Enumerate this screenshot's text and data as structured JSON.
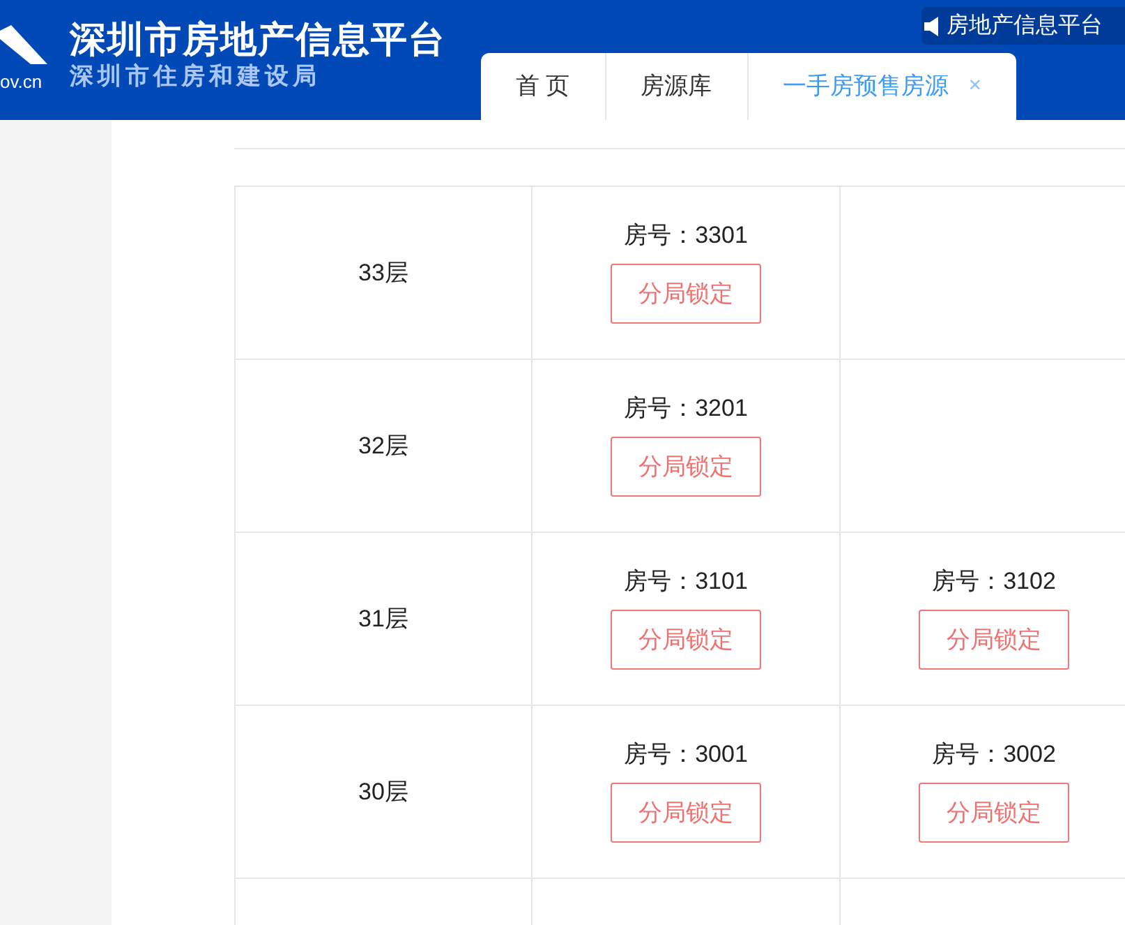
{
  "header": {
    "logo_text": "ov.cn",
    "title": "深圳市房地产信息平台",
    "subtitle": "深圳市住房和建设局",
    "marquee": "房地产信息平台"
  },
  "tabs": [
    {
      "label": "首 页",
      "selected": false
    },
    {
      "label": "房源库",
      "selected": false
    },
    {
      "label": "一手房预售房源",
      "selected": true,
      "close": "×"
    }
  ],
  "floors": [
    {
      "floor": "33层",
      "rooms": [
        {
          "number": "房号：3301",
          "status": "分局锁定"
        }
      ]
    },
    {
      "floor": "32层",
      "rooms": [
        {
          "number": "房号：3201",
          "status": "分局锁定"
        }
      ]
    },
    {
      "floor": "31层",
      "rooms": [
        {
          "number": "房号：3101",
          "status": "分局锁定"
        },
        {
          "number": "房号：3102",
          "status": "分局锁定"
        }
      ]
    },
    {
      "floor": "30层",
      "rooms": [
        {
          "number": "房号：3001",
          "status": "分局锁定"
        },
        {
          "number": "房号：3002",
          "status": "分局锁定"
        }
      ]
    }
  ]
}
